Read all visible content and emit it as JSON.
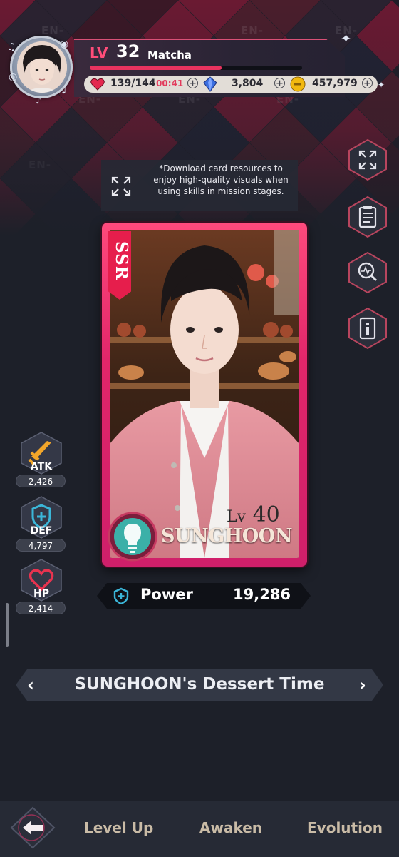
{
  "header": {
    "level_label": "LV",
    "level": "32",
    "player_name": "Matcha",
    "xp_progress": 0.62
  },
  "resources": {
    "stamina": "139/144",
    "stamina_timer": "00:41",
    "gems": "3,804",
    "coins": "457,979"
  },
  "download_tip": "*Download card resources to enjoy high-quality visuals when using skills in mission stages.",
  "card": {
    "rarity": "SSR",
    "level_label": "Lv",
    "level": "40",
    "member_name": "SUNGHOON"
  },
  "stats": {
    "atk_label": "ATK",
    "atk": "2,426",
    "def_label": "DEF",
    "def": "4,797",
    "hp_label": "HP",
    "hp": "2,414"
  },
  "power": {
    "label": "Power",
    "value": "19,286"
  },
  "card_title": "SUNGHOON's Dessert Time",
  "nav": {
    "level_up": "Level Up",
    "awaken": "Awaken",
    "evolution": "Evolution"
  },
  "background_logo": "EN-",
  "colors": {
    "accent_pink": "#ff4d79",
    "card_frame": "#e2266a",
    "nav_text": "#c9bba6"
  }
}
